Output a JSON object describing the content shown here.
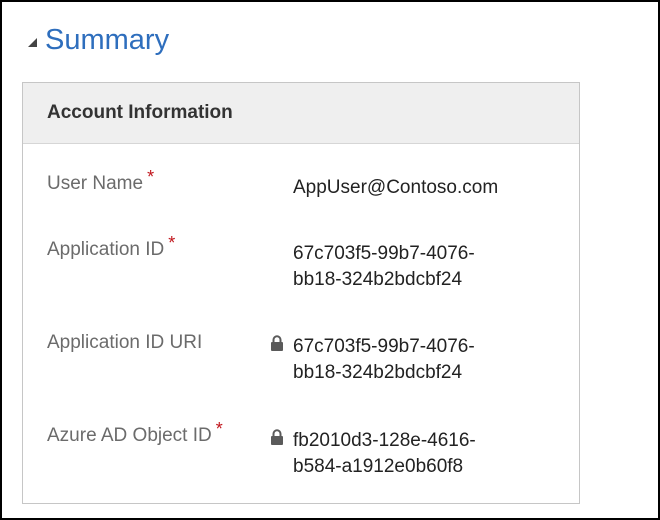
{
  "section": {
    "title": "Summary"
  },
  "card": {
    "title": "Account Information"
  },
  "fields": [
    {
      "label": "User Name",
      "required": "*",
      "value": "AppUser@Contoso.com",
      "locked": false
    },
    {
      "label": "Application ID",
      "required": "*",
      "value_line1": "67c703f5-99b7-4076-",
      "value_line2": "bb18-324b2bdcbf24",
      "locked": false
    },
    {
      "label": "Application ID URI",
      "required": "",
      "value_line1": "67c703f5-99b7-4076-",
      "value_line2": "bb18-324b2bdcbf24",
      "locked": true
    },
    {
      "label": "Azure AD Object ID",
      "required": "*",
      "value_line1": "fb2010d3-128e-4616-",
      "value_line2": "b584-a1912e0b60f8",
      "locked": true
    }
  ],
  "icons": {
    "collapse": "collapse-triangle-icon",
    "lock": "lock-icon"
  },
  "colors": {
    "title": "#2e6ebd",
    "required": "#c0141b",
    "label": "#6b6b6b",
    "header_bg": "#efefef"
  }
}
